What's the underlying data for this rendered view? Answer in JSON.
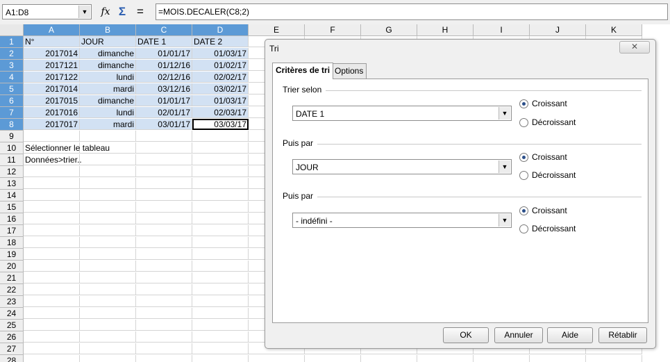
{
  "formula_bar": {
    "name_box": "A1:D8",
    "fx_icon": "function-wizard-icon",
    "sigma_icon": "sum-icon",
    "equals_icon": "formula-icon",
    "formula": "=MOIS.DECALER(C8;2)"
  },
  "columns": [
    "A",
    "B",
    "C",
    "D",
    "E",
    "F",
    "G",
    "H",
    "I",
    "J",
    "K"
  ],
  "rows": [
    {
      "n": "1",
      "cells": [
        "N°",
        "JOUR",
        "DATE 1",
        "DATE 2"
      ]
    },
    {
      "n": "2",
      "cells": [
        "2017014",
        "dimanche",
        "01/01/17",
        "01/03/17"
      ]
    },
    {
      "n": "3",
      "cells": [
        "2017121",
        "dimanche",
        "01/12/16",
        "01/02/17"
      ]
    },
    {
      "n": "4",
      "cells": [
        "2017122",
        "lundi",
        "02/12/16",
        "02/02/17"
      ]
    },
    {
      "n": "5",
      "cells": [
        "2017014",
        "mardi",
        "03/12/16",
        "03/02/17"
      ]
    },
    {
      "n": "6",
      "cells": [
        "2017015",
        "dimanche",
        "01/01/17",
        "01/03/17"
      ]
    },
    {
      "n": "7",
      "cells": [
        "2017016",
        "lundi",
        "02/01/17",
        "02/03/17"
      ]
    },
    {
      "n": "8",
      "cells": [
        "2017017",
        "mardi",
        "03/01/17",
        "03/03/17"
      ]
    },
    {
      "n": "9",
      "cells": [
        "",
        "",
        "",
        ""
      ]
    },
    {
      "n": "10",
      "cells": [
        "Sélectionner le tableau",
        "",
        "",
        ""
      ]
    },
    {
      "n": "11",
      "cells": [
        "Données>trier..",
        "",
        "",
        ""
      ]
    },
    {
      "n": "12",
      "cells": []
    },
    {
      "n": "13",
      "cells": []
    },
    {
      "n": "14",
      "cells": []
    },
    {
      "n": "15",
      "cells": []
    },
    {
      "n": "16",
      "cells": []
    },
    {
      "n": "17",
      "cells": []
    },
    {
      "n": "18",
      "cells": []
    },
    {
      "n": "19",
      "cells": []
    },
    {
      "n": "20",
      "cells": []
    },
    {
      "n": "21",
      "cells": []
    },
    {
      "n": "22",
      "cells": []
    },
    {
      "n": "23",
      "cells": []
    },
    {
      "n": "24",
      "cells": []
    },
    {
      "n": "25",
      "cells": []
    },
    {
      "n": "26",
      "cells": []
    },
    {
      "n": "27",
      "cells": []
    },
    {
      "n": "28",
      "cells": []
    }
  ],
  "dialog": {
    "title": "Tri",
    "close_symbol": "✕",
    "tabs": [
      "Critères de tri",
      "Options"
    ],
    "sections": [
      {
        "label": "Trier selon",
        "value": "DATE 1",
        "asc": "Croissant",
        "desc": "Décroissant",
        "selected": "asc"
      },
      {
        "label": "Puis par",
        "value": "JOUR",
        "asc": "Croissant",
        "desc": "Décroissant",
        "selected": "asc"
      },
      {
        "label": "Puis par",
        "value": "- indéfini -",
        "asc": "Croissant",
        "desc": "Décroissant",
        "selected": "asc"
      }
    ],
    "buttons": {
      "ok": "OK",
      "cancel": "Annuler",
      "help": "Aide",
      "reset": "Rétablir"
    }
  }
}
